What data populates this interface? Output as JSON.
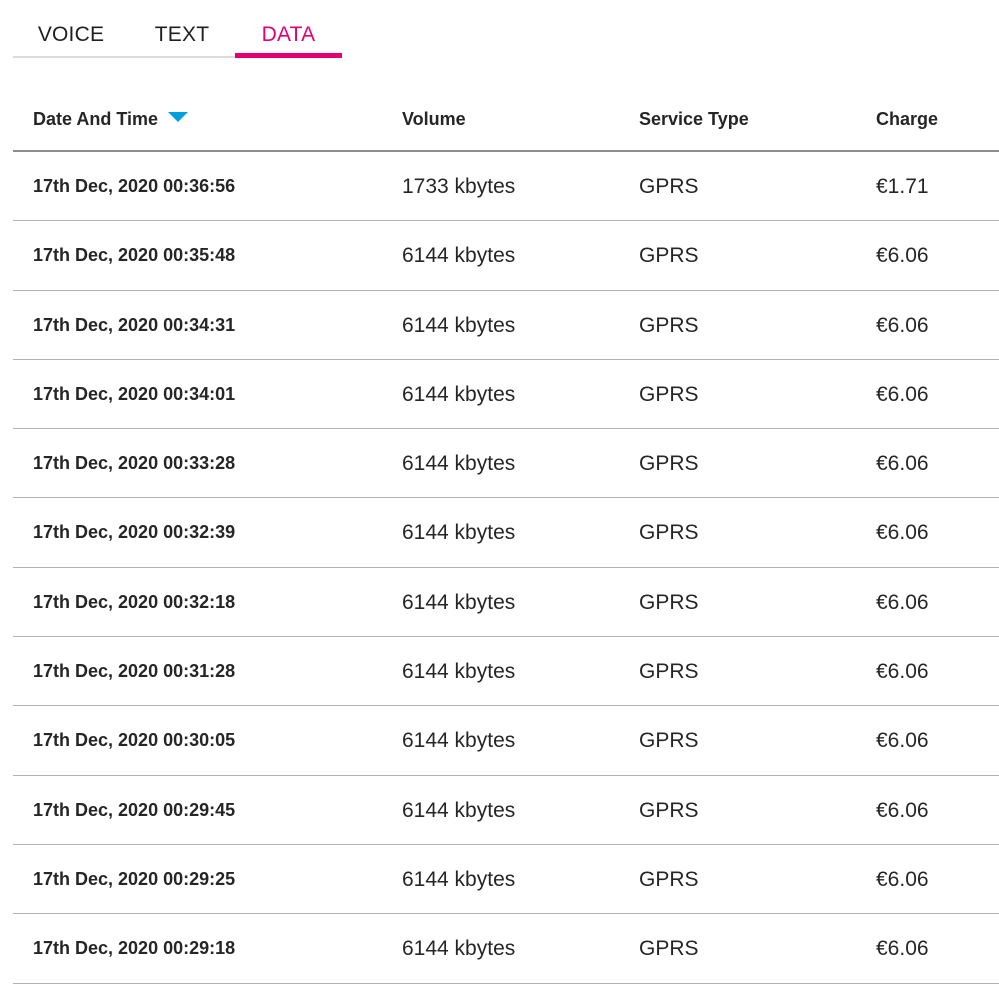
{
  "accent_color": "#e20074",
  "sort_indicator_color": "#00a0de",
  "tabs": [
    {
      "label": "VOICE",
      "active": false
    },
    {
      "label": "TEXT",
      "active": false
    },
    {
      "label": "DATA",
      "active": true
    }
  ],
  "table": {
    "columns": [
      "Date And Time",
      "Volume",
      "Service Type",
      "Charge"
    ],
    "sort": {
      "column": "Date And Time",
      "direction": "descending",
      "icon": "caret-down-icon"
    },
    "rows": [
      {
        "date": "17th Dec, 2020 00:36:56",
        "volume": "1733 kbytes",
        "service": "GPRS",
        "charge": "€1.71"
      },
      {
        "date": "17th Dec, 2020 00:35:48",
        "volume": "6144 kbytes",
        "service": "GPRS",
        "charge": "€6.06"
      },
      {
        "date": "17th Dec, 2020 00:34:31",
        "volume": "6144 kbytes",
        "service": "GPRS",
        "charge": "€6.06"
      },
      {
        "date": "17th Dec, 2020 00:34:01",
        "volume": "6144 kbytes",
        "service": "GPRS",
        "charge": "€6.06"
      },
      {
        "date": "17th Dec, 2020 00:33:28",
        "volume": "6144 kbytes",
        "service": "GPRS",
        "charge": "€6.06"
      },
      {
        "date": "17th Dec, 2020 00:32:39",
        "volume": "6144 kbytes",
        "service": "GPRS",
        "charge": "€6.06"
      },
      {
        "date": "17th Dec, 2020 00:32:18",
        "volume": "6144 kbytes",
        "service": "GPRS",
        "charge": "€6.06"
      },
      {
        "date": "17th Dec, 2020 00:31:28",
        "volume": "6144 kbytes",
        "service": "GPRS",
        "charge": "€6.06"
      },
      {
        "date": "17th Dec, 2020 00:30:05",
        "volume": "6144 kbytes",
        "service": "GPRS",
        "charge": "€6.06"
      },
      {
        "date": "17th Dec, 2020 00:29:45",
        "volume": "6144 kbytes",
        "service": "GPRS",
        "charge": "€6.06"
      },
      {
        "date": "17th Dec, 2020 00:29:25",
        "volume": "6144 kbytes",
        "service": "GPRS",
        "charge": "€6.06"
      },
      {
        "date": "17th Dec, 2020 00:29:18",
        "volume": "6144 kbytes",
        "service": "GPRS",
        "charge": "€6.06"
      }
    ]
  }
}
